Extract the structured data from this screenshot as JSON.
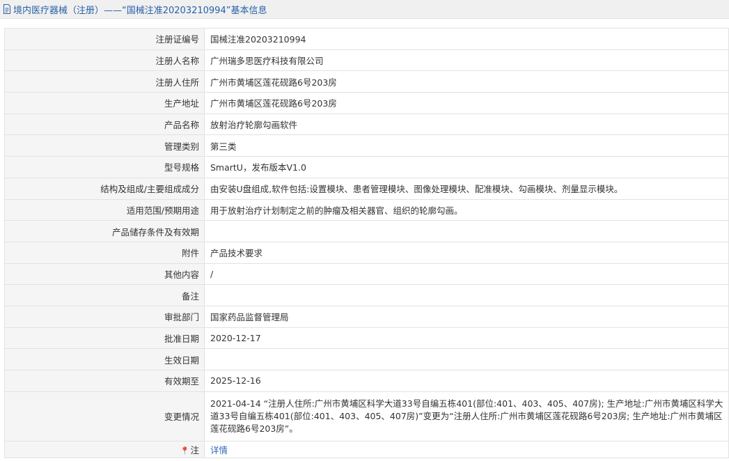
{
  "header": {
    "title": "境内医疗器械（注册）——“国械注准20203210994”基本信息"
  },
  "rows": [
    {
      "label": "注册证编号",
      "value": "国械注准20203210994"
    },
    {
      "label": "注册人名称",
      "value": "广州瑞多思医疗科技有限公司"
    },
    {
      "label": "注册人住所",
      "value": "广州市黄埔区莲花砚路6号203房"
    },
    {
      "label": "生产地址",
      "value": "广州市黄埔区莲花砚路6号203房"
    },
    {
      "label": "产品名称",
      "value": "放射治疗轮廓勾画软件"
    },
    {
      "label": "管理类别",
      "value": "第三类"
    },
    {
      "label": "型号规格",
      "value": "SmartU，发布版本V1.0"
    },
    {
      "label": "结构及组成/主要组成成分",
      "value": "由安装U盘组成,软件包括:设置模块、患者管理模块、图像处理模块、配准模块、勾画模块、剂量显示模块。"
    },
    {
      "label": "适用范围/预期用途",
      "value": "用于放射治疗计划制定之前的肿瘤及相关器官、组织的轮廓勾画。"
    },
    {
      "label": "产品储存条件及有效期",
      "value": ""
    },
    {
      "label": "附件",
      "value": "产品技术要求"
    },
    {
      "label": "其他内容",
      "value": "/"
    },
    {
      "label": "备注",
      "value": ""
    },
    {
      "label": "审批部门",
      "value": "国家药品监督管理局"
    },
    {
      "label": "批准日期",
      "value": "2020-12-17"
    },
    {
      "label": "生效日期",
      "value": ""
    },
    {
      "label": "有效期至",
      "value": "2025-12-16"
    },
    {
      "label": "变更情况",
      "value": "2021-04-14 “注册人住所:广州市黄埔区科学大道33号自编五栋401(部位:401、403、405、407房); 生产地址:广州市黄埔区科学大道33号自编五栋401(部位:401、403、405、407房)”变更为“注册人住所:广州市黄埔区莲花砚路6号203房; 生产地址:广州市黄埔区莲花砚路6号203房”。"
    }
  ],
  "note": {
    "label": "注",
    "pin_icon": "pin-icon",
    "link": "详情"
  }
}
